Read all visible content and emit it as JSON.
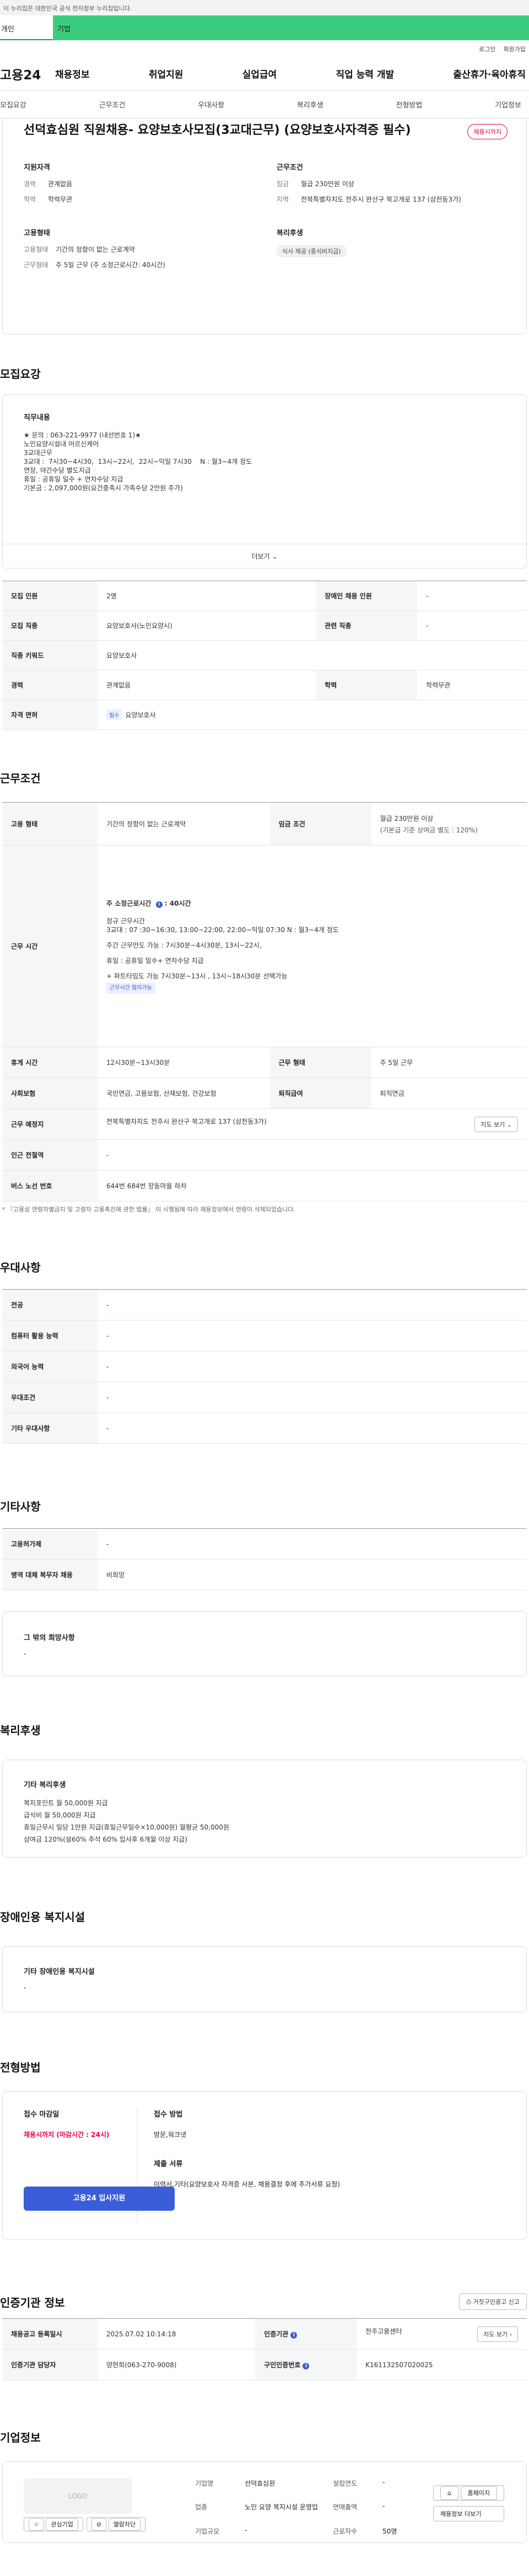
{
  "gov_notice": "이 누리집은 대한민국 공식 전자정부 누리집입니다.",
  "tabs": [
    "개인",
    "기업"
  ],
  "util": [
    "로그인",
    "회원가입"
  ],
  "logo": "고용24",
  "gnb": [
    "채용정보",
    "취업지원",
    "실업급여",
    "직업 능력 개발",
    "출산휴가·육아휴직"
  ],
  "anchors": [
    "모집요강",
    "근무조건",
    "우대사항",
    "복리후생",
    "전형방법",
    "기업정보"
  ],
  "job": {
    "title": "선덕효심원 직원채용- 요양보호사모집(3교대근무) (요양보호사자격증 필수)",
    "status": "채용시까지",
    "qual_title": "지원자격",
    "career_k": "경력",
    "career_v": "관계없음",
    "edu_k": "학력",
    "edu_v": "학력무관",
    "cond_title": "근무조건",
    "wage_k": "임금",
    "wage_v": "월급 230만원 이상",
    "area_k": "지역",
    "area_v": "전북특별자치도 전주시 완산구 북고개로 137 (삼천동3가)",
    "emp_title": "고용형태",
    "emp_k": "고용형태",
    "emp_v": "기간의 정함이 없는 근로계약",
    "wt_k": "근무형태",
    "wt_v": "주 5일 근무 (주 소정근로시간: 40시간)",
    "welf_title": "복리후생",
    "welf_tag": "식사 제공 (중식비지급)"
  },
  "recruit": {
    "title": "모집요강",
    "desc_title": "직무내용",
    "desc_lines": [
      "★ 문의 : 063-221-9977 (내선번호 1)★",
      "",
      "노인요양시설내 어르신케어",
      "3교대근무",
      "3교대 :  7시30~4시30,  13시~22시,  22시~익일 7시30    N : 월3~4개 정도",
      "연장, 야간수당 별도지급",
      "",
      "휴일 : 공휴일 일수 + 연차수당 지급",
      "기본금 : 2,097,000원(요건충족시 가족수당 2만원 추가)"
    ],
    "more": "더보기",
    "rows": [
      {
        "k1": "모집 인원",
        "v1": "2명",
        "k2": "장애인 채용 인원",
        "v2": "-"
      },
      {
        "k1": "모집 직종",
        "v1": "요양보호사(노인요양시)",
        "k2": "관련 직종",
        "v2": "-"
      },
      {
        "k1": "직종 키워드",
        "v1": "요양보호사"
      },
      {
        "k1": "경력",
        "v1": "관계없음",
        "k2": "학력",
        "v2": "학력무관"
      },
      {
        "k1": "자격 면허",
        "tag": "필수",
        "v1": "요양보호사"
      }
    ]
  },
  "work": {
    "title": "근무조건",
    "emp_k": "고용 형태",
    "emp_v": "기간의 정함이 없는 근로계약",
    "wage_k": "임금 조건",
    "wage_v1": "월급 230만원 이상",
    "wage_v2": "(기본급 기준 상여금 별도 : 120%)",
    "time_k": "근무 시간",
    "hours_label": "주 소정근로시간",
    "hours_val": "40시간",
    "time_lines": [
      "",
      "정규 근무시간",
      "3교대 : 07 :30~16:30, 13:00~22:00, 22:00~익일 07:30   N : 월3~4개 정도",
      "",
      "주간 근무만도 가능 :  7시30분~4시30분, 13시~22시,",
      "",
      "휴일 : 공휴일 일수+ 연차수당 지급",
      "",
      "+ 파트타임도 가능    7시30분~13시 ,  13시~18시30분   선택가능"
    ],
    "flex_tag": "근무시간 협의가능",
    "break_k": "휴게 시간",
    "break_v": "12시30분~13시30분",
    "form_k": "근무 형태",
    "form_v": "주 5일 근무",
    "ins_k": "사회보험",
    "ins_v": "국민연금, 고용보험, 산재보험, 건강보험",
    "ret_k": "퇴직급여",
    "ret_v": "퇴직연금",
    "place_k": "근무 예정지",
    "place_v": "전북특별자치도 전주시 완산구 북고개로 137 (삼천동3가)",
    "map": "지도 보기",
    "sub_k": "인근 전철역",
    "sub_v": "-",
    "bus_k": "버스 노선 번호",
    "bus_v": "644번 684번 장동마을 하차",
    "note": "* 『고용상 연령차별금지 및 고령자 고용촉진에 관한 법률』 이 시행됨에 따라 채용정보에서 연령이 삭제되었습니다."
  },
  "pref": {
    "title": "우대사항",
    "rows": [
      {
        "k": "전공",
        "v": "-"
      },
      {
        "k": "컴퓨터 활용 능력",
        "v": "-"
      },
      {
        "k": "외국어 능력",
        "v": "-"
      },
      {
        "k": "우대조건",
        "v": "-"
      },
      {
        "k": "기타 우대사항",
        "v": "-"
      }
    ]
  },
  "etc": {
    "title": "기타사항",
    "rows": [
      {
        "k": "고용허가제",
        "v": "-"
      },
      {
        "k": "병역 대체 복무자 채용",
        "v": "비희망"
      }
    ],
    "box_title": "그 밖의 희망사항",
    "box_v": "-"
  },
  "welfare": {
    "title": "복리후생",
    "box_title": "기타 복리후생",
    "lines": [
      "복지포인트 월 50,000원 지급",
      "급식비 월 50,000원 지급",
      "휴일근무시 일당 1만원 지급(휴일근무일수×10,000원) 월평균 50,000원",
      "상여금 120%(설60% 추석 60% 입사후 6개월 이상 지급)"
    ]
  },
  "disab": {
    "title": "장애인용 복지시설",
    "box_title": "기타 장애인용 복지시설",
    "box_v": "-"
  },
  "apply": {
    "title": "전형방법",
    "deadline_title": "접수 마감일",
    "deadline_v": "채용시까지 (마감시간 : 24시)",
    "btn": "고용24 입사지원",
    "method_title": "접수 방법",
    "method_v": "방문,워크넷",
    "doc_title": "제출 서류",
    "doc_v": "이력서,기타(요양보호사 자격증 사본,  채용결정 후에 추가서류 요청)"
  },
  "cert": {
    "title": "인증기관 정보",
    "report": "거짓구인광고 신고",
    "reg_k": "채용공고 등록일시",
    "reg_v": "2025.07.02 10:14:18",
    "org_k": "인증기관",
    "org_v": "전주고용센터",
    "map": "지도 보기",
    "mgr_k": "인증기관 담당자",
    "mgr_v": "양현희(063-270-9008)",
    "no_k": "구인인증번호",
    "no_v": "K161132507020025"
  },
  "company": {
    "title": "기업정보",
    "logo": "LOGO",
    "fav": "관심기업",
    "block": "열람차단",
    "name_k": "기업명",
    "name_v": "선덕효심원",
    "year_k": "설립연도",
    "year_v": "-",
    "biz_k": "업종",
    "biz_v": "노인 요양 복지시설 운영업",
    "sales_k": "연매출액",
    "sales_v": "-",
    "emp_k": "근로자수",
    "emp_v": "50명",
    "size_k": "기업규모",
    "size_v": "-",
    "home": "홈페이지",
    "more": "채용정보 더보기"
  }
}
